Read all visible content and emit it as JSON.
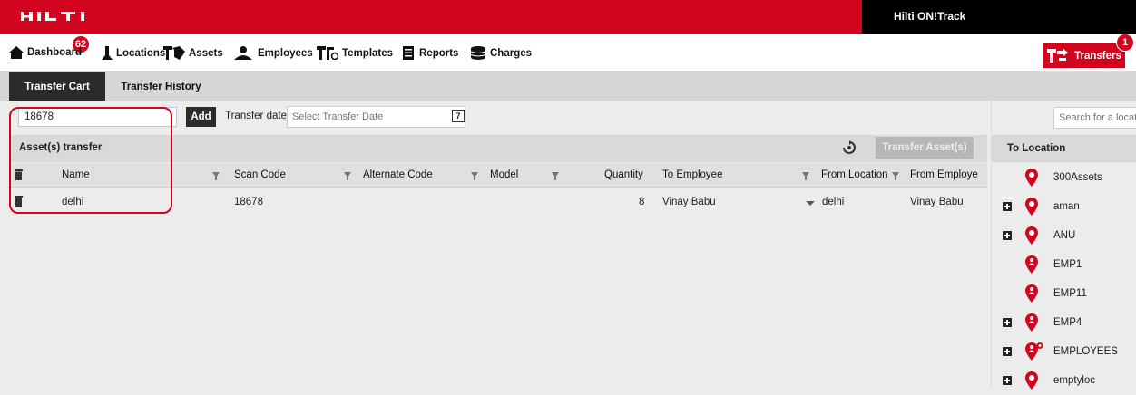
{
  "app": {
    "logo_text": "HILTI",
    "brand_title": "Hilti ON!Track",
    "accent_color": "#d2051e"
  },
  "nav": {
    "dashboard_badge": "62",
    "items": [
      {
        "label": "Dashboard",
        "icon": "home-icon"
      },
      {
        "label": "Locations",
        "icon": "location-marker-icon"
      },
      {
        "label": "Assets",
        "icon": "assets-icon"
      },
      {
        "label": "Employees",
        "icon": "employees-icon"
      },
      {
        "label": "Templates",
        "icon": "templates-icon"
      },
      {
        "label": "Reports",
        "icon": "reports-icon"
      },
      {
        "label": "Charges",
        "icon": "charges-icon"
      }
    ],
    "transfers": {
      "label": "Transfers",
      "badge": "1",
      "icon": "transfer-icon"
    }
  },
  "tabs": [
    {
      "label": "Transfer Cart",
      "active": true
    },
    {
      "label": "Transfer History",
      "active": false
    }
  ],
  "toolbar": {
    "scan_value": "18678",
    "add_label": "Add",
    "transfer_date_label": "Transfer date",
    "transfer_date_placeholder": "Select Transfer Date",
    "calendar_day": "7"
  },
  "asset_transfer": {
    "title": "Asset(s) transfer",
    "transfer_button": "Transfer Asset(s)",
    "columns": [
      "Name",
      "Scan Code",
      "Alternate Code",
      "Model",
      "Quantity",
      "To Employee",
      "From Location",
      "From Employe"
    ],
    "rows": [
      {
        "name": "delhi",
        "scan_code": "18678",
        "alternate_code": "",
        "model": "",
        "quantity": "8",
        "to_employee": "Vinay Babu",
        "from_location": "delhi",
        "from_employee": "Vinay Babu"
      }
    ]
  },
  "right_panel": {
    "search_placeholder": "Search for a locati",
    "title": "To Location",
    "locations": [
      {
        "name": "300Assets",
        "expandable": false,
        "icon": "location-pin-icon"
      },
      {
        "name": "aman",
        "expandable": true,
        "icon": "location-pin-icon"
      },
      {
        "name": "ANU",
        "expandable": true,
        "icon": "location-pin-icon"
      },
      {
        "name": "EMP1",
        "expandable": false,
        "icon": "employee-pin-icon"
      },
      {
        "name": "EMP11",
        "expandable": false,
        "icon": "employee-pin-icon"
      },
      {
        "name": "EMP4",
        "expandable": true,
        "icon": "employee-pin-icon"
      },
      {
        "name": "EMPLOYEES",
        "expandable": true,
        "icon": "employee-group-pin-icon"
      },
      {
        "name": "emptyloc",
        "expandable": true,
        "icon": "location-pin-icon"
      }
    ]
  }
}
